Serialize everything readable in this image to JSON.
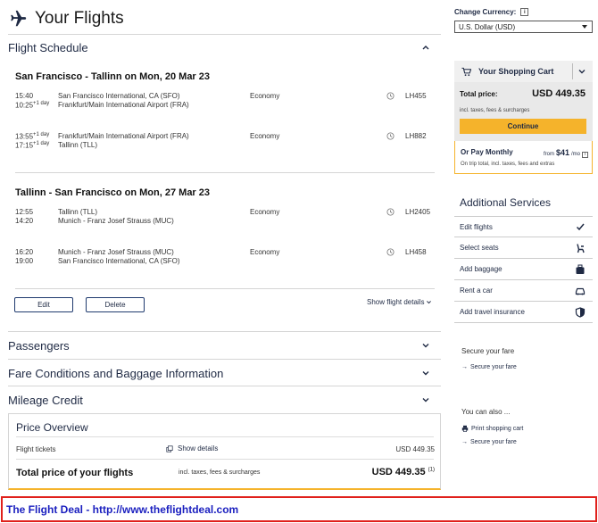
{
  "header": {
    "title": "Your Flights"
  },
  "sections": {
    "flight_schedule": "Flight Schedule",
    "passengers": "Passengers",
    "fare_conditions": "Fare Conditions and Baggage Information",
    "mileage_credit": "Mileage Credit"
  },
  "journeys": [
    {
      "route": "San Francisco - Tallinn on Mon, 20 Mar 23",
      "segments": [
        {
          "dep_time": "15:40",
          "arr_time": "10:25",
          "arr_day": "+1 day",
          "dep_airport": "San Francisco International, CA (SFO)",
          "arr_airport": "Frankfurt/Main International Airport (FRA)",
          "cabin": "Economy",
          "flight": "LH455"
        },
        {
          "dep_time": "13:55",
          "dep_day": "+1 day",
          "arr_time": "17:15",
          "arr_day": "+1 day",
          "dep_airport": "Frankfurt/Main International Airport (FRA)",
          "arr_airport": "Tallinn (TLL)",
          "cabin": "Economy",
          "flight": "LH882"
        }
      ]
    },
    {
      "route": "Tallinn - San Francisco on Mon, 27 Mar 23",
      "segments": [
        {
          "dep_time": "12:55",
          "arr_time": "14:20",
          "dep_airport": "Tallinn (TLL)",
          "arr_airport": "Munich - Franz Josef Strauss (MUC)",
          "cabin": "Economy",
          "flight": "LH2405"
        },
        {
          "dep_time": "16:20",
          "arr_time": "19:00",
          "dep_airport": "Munich - Franz Josef Strauss (MUC)",
          "arr_airport": "San Francisco International, CA (SFO)",
          "cabin": "Economy",
          "flight": "LH458"
        }
      ]
    }
  ],
  "actions": {
    "edit": "Edit",
    "delete": "Delete",
    "show_flight_details": "Show flight details"
  },
  "price_overview": {
    "title": "Price Overview",
    "flight_tickets": "Flight tickets",
    "show_details": "Show details",
    "flight_amount": "USD 449.35",
    "total_label": "Total price of your flights",
    "incl_note": "incl. taxes, fees & surcharges",
    "total_amount": "USD 449.35",
    "footnote": "(1)"
  },
  "currency": {
    "label": "Change Currency:",
    "info": "i",
    "selected": "U.S. Dollar (USD)"
  },
  "cart": {
    "title": "Your Shopping Cart",
    "total_label": "Total price:",
    "total_amount": "USD 449.35",
    "incl_note": "incl. taxes, fees & surcharges",
    "continue": "Continue"
  },
  "monthly": {
    "title": "Or Pay Monthly",
    "from": "from",
    "amount": "$41",
    "per": "/mo",
    "note": "On trip total, incl. taxes, fees and extras"
  },
  "additional_services": {
    "title": "Additional Services",
    "items": [
      {
        "label": "Edit flights",
        "icon": "check-icon"
      },
      {
        "label": "Select seats",
        "icon": "seat-icon"
      },
      {
        "label": "Add baggage",
        "icon": "baggage-icon"
      },
      {
        "label": "Rent a car",
        "icon": "car-icon"
      },
      {
        "label": "Add travel insurance",
        "icon": "shield-icon"
      }
    ]
  },
  "secure_fare": {
    "title": "Secure your fare",
    "link": "Secure your fare"
  },
  "also": {
    "title": "You can also ...",
    "print": "Print shopping cart",
    "secure": "Secure your fare"
  },
  "banner": {
    "text": "The Flight Deal - http://www.theflightdeal.com"
  },
  "colors": {
    "accent": "#f5b32b",
    "navy": "#1f2a44",
    "banner_border": "#e0201b",
    "banner_text": "#1a1fbf"
  }
}
